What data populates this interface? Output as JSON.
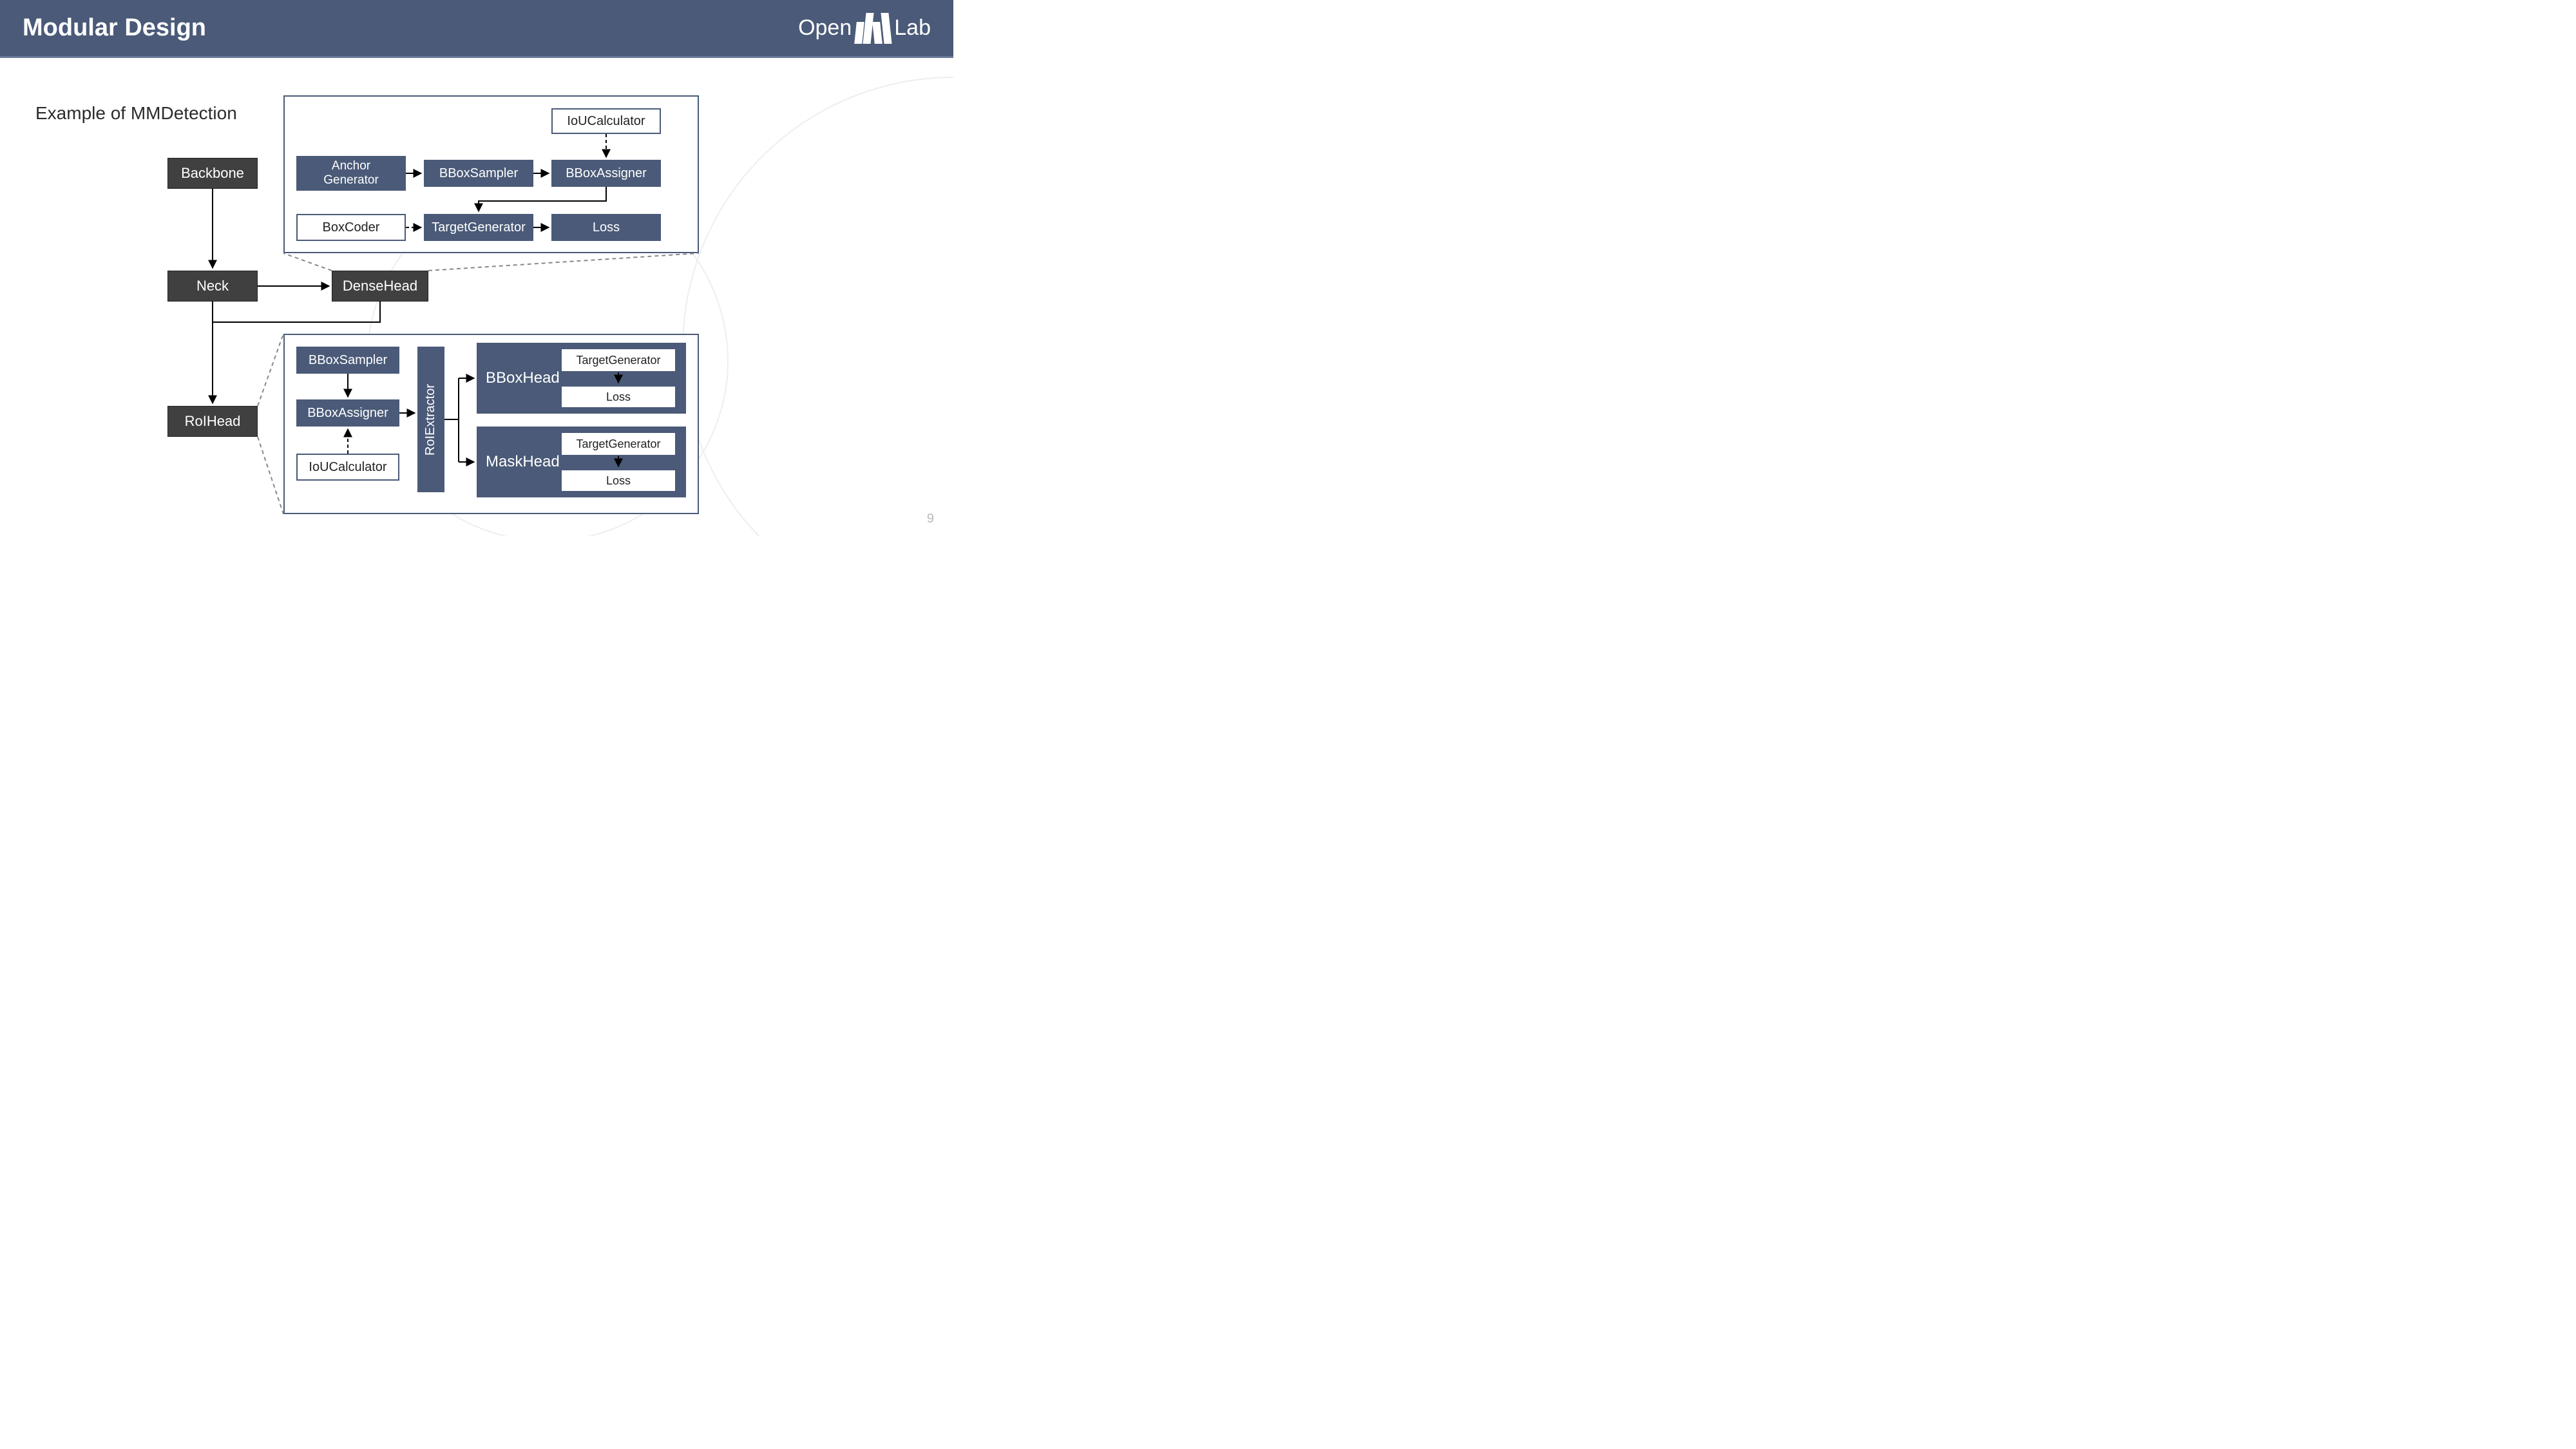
{
  "header": {
    "title": "Modular Design",
    "logo_open": "Open",
    "logo_lab": "Lab"
  },
  "subtitle": "Example of MMDetection",
  "pipeline": {
    "backbone": "Backbone",
    "neck": "Neck",
    "densehead": "DenseHead",
    "roihead": "RoIHead"
  },
  "densehead_panel": {
    "iou_calculator": "IoUCalculator",
    "anchor_generator": "Anchor\nGenerator",
    "bbox_sampler": "BBoxSampler",
    "bbox_assigner": "BBoxAssigner",
    "box_coder": "BoxCoder",
    "target_generator": "TargetGenerator",
    "loss": "Loss"
  },
  "roihead_panel": {
    "bbox_sampler": "BBoxSampler",
    "bbox_assigner": "BBoxAssigner",
    "iou_calculator": "IoUCalculator",
    "roi_extractor": "RoIExtractor",
    "bbox_head": "BBoxHead",
    "mask_head": "MaskHead",
    "target_generator1": "TargetGenerator",
    "loss1": "Loss",
    "target_generator2": "TargetGenerator",
    "loss2": "Loss"
  },
  "page_number": "9"
}
